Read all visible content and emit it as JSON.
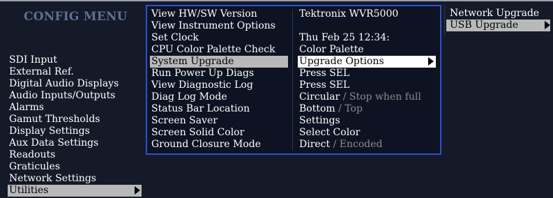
{
  "title": "CONFIG MENU",
  "left_menu": [
    {
      "label": "SDI Input",
      "selected": false
    },
    {
      "label": "External Ref.",
      "selected": false
    },
    {
      "label": "Digital Audio Displays",
      "selected": false
    },
    {
      "label": "Audio Inputs/Outputs",
      "selected": false
    },
    {
      "label": "Alarms",
      "selected": false
    },
    {
      "label": "Gamut Thresholds",
      "selected": false
    },
    {
      "label": "Display Settings",
      "selected": false
    },
    {
      "label": "Aux Data Settings",
      "selected": false
    },
    {
      "label": "Readouts",
      "selected": false
    },
    {
      "label": "Graticules",
      "selected": false
    },
    {
      "label": "Network Settings",
      "selected": false
    },
    {
      "label": "Utilities",
      "selected": true
    }
  ],
  "utilities": [
    {
      "label": "View HW/SW Version",
      "value": "Tektronix WVR5000",
      "value_dim": ""
    },
    {
      "label": "View Instrument Options",
      "value": "",
      "value_dim": ""
    },
    {
      "label": "Set Clock",
      "value": "Thu Feb 25 12:34:",
      "value_dim": ""
    },
    {
      "label": "CPU Color Palette Check",
      "value": "Color Palette",
      "value_dim": ""
    },
    {
      "label": "System Upgrade",
      "value": "Upgrade Options",
      "value_dim": "",
      "selected": true
    },
    {
      "label": "Run Power Up Diags",
      "value": "Press SEL",
      "value_dim": ""
    },
    {
      "label": "View Diagnostic Log",
      "value": "Press SEL",
      "value_dim": ""
    },
    {
      "label": "Diag Log Mode",
      "value": "Circular",
      "value_dim": "/ Stop when full"
    },
    {
      "label": "Status Bar Location",
      "value": "Bottom",
      "value_dim": "/ Top"
    },
    {
      "label": "Screen Saver",
      "value": "Settings",
      "value_dim": ""
    },
    {
      "label": "Screen Solid Color",
      "value": "Select Color",
      "value_dim": ""
    },
    {
      "label": "Ground Closure Mode",
      "value": "Direct",
      "value_dim": "/ Encoded"
    }
  ],
  "upgrade_options": [
    {
      "label": "Network Upgrade",
      "selected": false
    },
    {
      "label": "USB Upgrade",
      "selected": true
    }
  ],
  "colors": {
    "background": "#141a28",
    "title": "#5f6f94",
    "highlight": "#b9b9b9",
    "panel_border": "#2e4fd0",
    "dim_text": "#8c8c8c"
  },
  "icons": {
    "submenu_arrow": "triangle-right-icon"
  }
}
